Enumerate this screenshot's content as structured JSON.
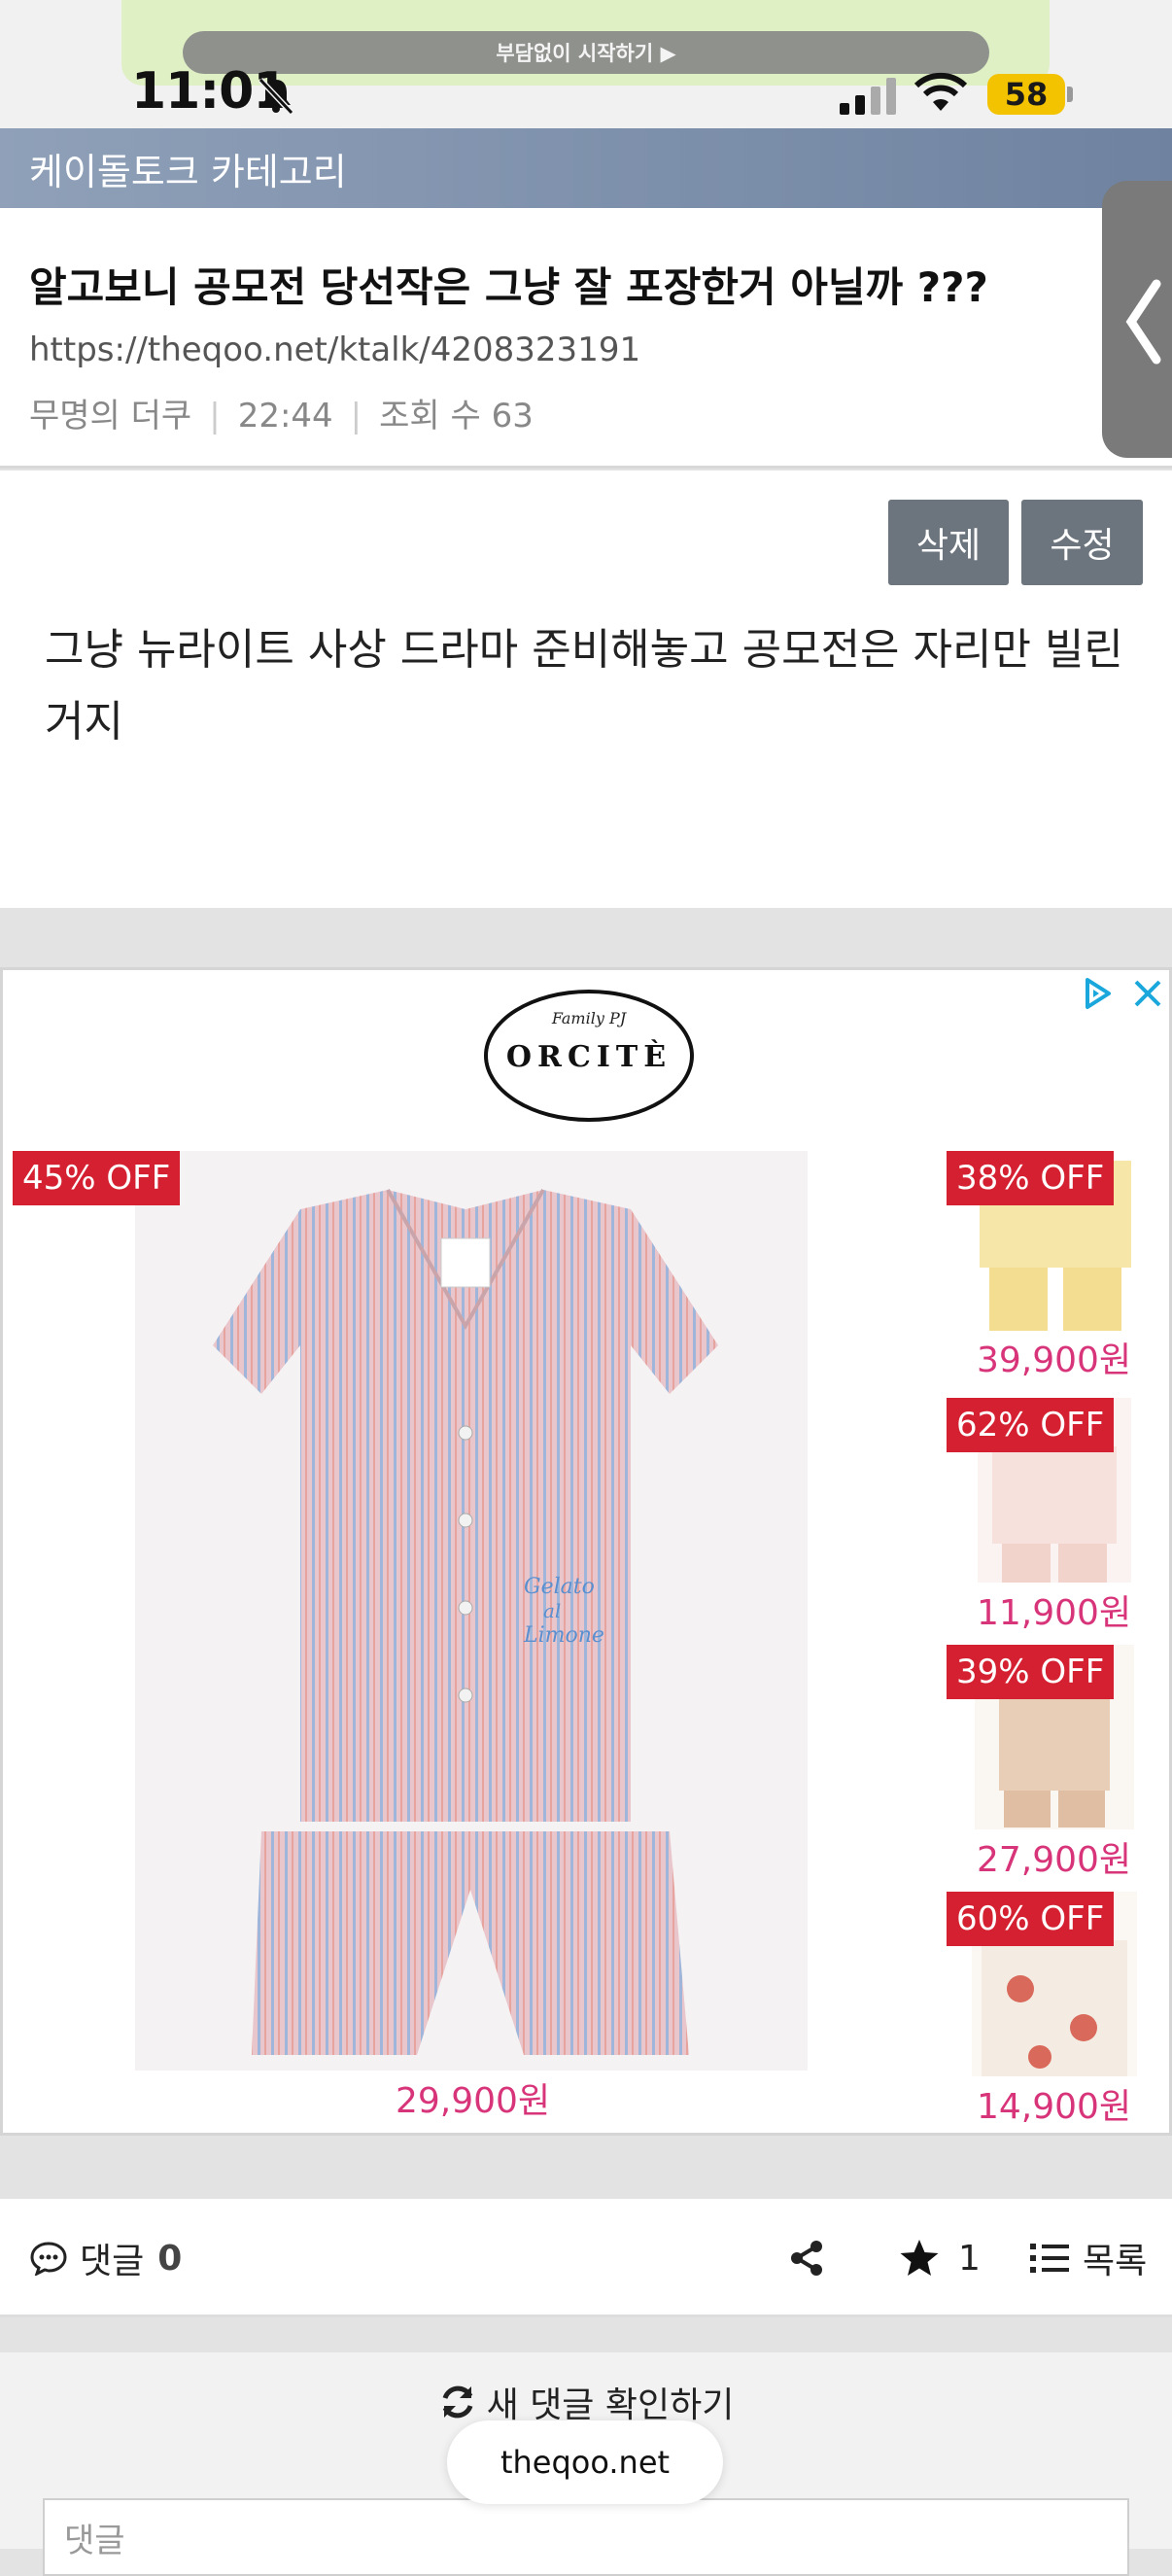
{
  "status_bar": {
    "time": "11:01",
    "battery": "58",
    "top_banner_text": "부담없이 시작하기 ▶"
  },
  "category_bar": {
    "title": "케이돌토크 카테고리"
  },
  "post": {
    "title": "알고보니 공모전 당선작은 그냥 잘 포장한거 아닐까 ???",
    "url": "https://theqoo.net/ktalk/4208323191",
    "author": "무명의 더쿠",
    "time": "22:44",
    "views": "조회 수 63",
    "delete_label": "삭제",
    "edit_label": "수정",
    "content": "그냥 뉴라이트 사상 드라마 준비해놓고 공모전은 자리만 빌린거지"
  },
  "ad": {
    "logo_top": "Family PJ",
    "logo_brand": "ORCITÈ",
    "main": {
      "badge": "45% OFF",
      "price": "29,900원"
    },
    "thumbs": [
      {
        "badge": "38% OFF",
        "price": "39,900원",
        "color": "#f6e7a8"
      },
      {
        "badge": "62% OFF",
        "price": "11,900원",
        "color": "#f7e1dc"
      },
      {
        "badge": "39% OFF",
        "price": "27,900원",
        "color": "#e8cdb7"
      },
      {
        "badge": "60% OFF",
        "price": "14,900원",
        "color": "#f4ece3"
      }
    ]
  },
  "comment_bar": {
    "comments_label": "댓글",
    "comments_count": "0",
    "star_count": "1",
    "list_label": "목록"
  },
  "refresh_label": "새 댓글 확인하기",
  "comment_placeholder": "댓글",
  "domain": "theqoo.net"
}
